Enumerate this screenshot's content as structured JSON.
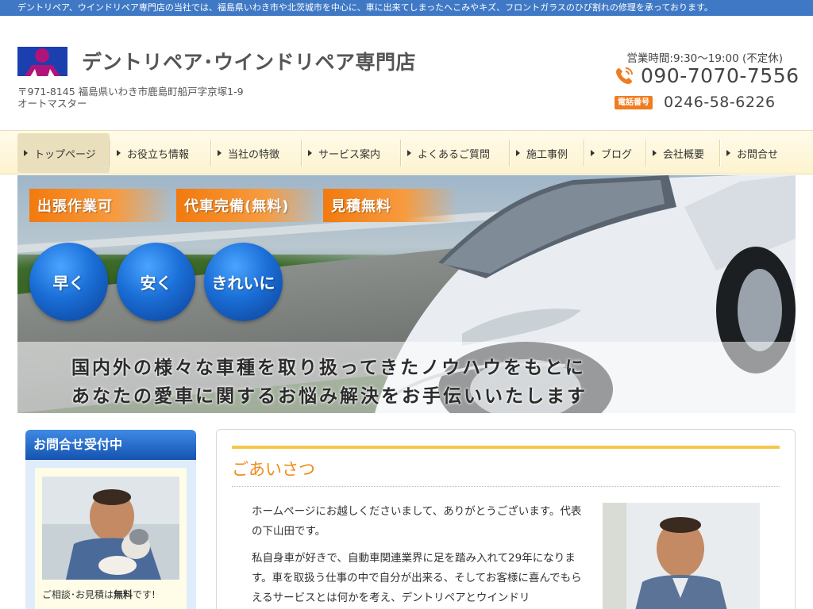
{
  "top_strip": {
    "text": "デントリペア、ウインドリペア専門店の当社では、福島県いわき市や北茨城市を中心に、車に出来てしまったへこみやキズ、フロントガラスのひび割れの修理を承っております。"
  },
  "header": {
    "title": "デントリペア･ウインドリペア専門店",
    "address_line1": "〒971-8145 福島県いわき市鹿島町船戸字京塚1-9",
    "address_line2": "オートマスター",
    "hours": "営業時間:9:30〜19:00 (不定休)",
    "phone_main": "090-7070-7556",
    "phone_badge": "電話番号",
    "phone_sub": "0246-58-6226"
  },
  "nav": {
    "items": [
      {
        "label": "トップページ"
      },
      {
        "label": "お役立ち情報"
      },
      {
        "label": "当社の特徴"
      },
      {
        "label": "サービス案内"
      },
      {
        "label": "よくあるご質問"
      },
      {
        "label": "施工事例"
      },
      {
        "label": "ブログ"
      },
      {
        "label": "会社概要"
      },
      {
        "label": "お問合せ"
      }
    ]
  },
  "hero": {
    "badges": [
      "出張作業可",
      "代車完備(無料)",
      "見積無料"
    ],
    "circles": [
      "早く",
      "安く",
      "きれいに"
    ],
    "line1": "国内外の様々な車種を取り扱ってきたノウハウをもとに",
    "line2": "あなたの愛車に関するお悩み解決をお手伝いいたします"
  },
  "sidebar": {
    "heading": "お問合せ受付中",
    "caption_prefix": "ご相談･お見積は",
    "caption_bold": "無料",
    "caption_suffix": "です!"
  },
  "content": {
    "heading": "ごあいさつ",
    "para1": "ホームページにお越しくださいまして、ありがとうございます。代表の下山田です。",
    "para2": "私自身車が好きで、自動車関連業界に足を踏み入れて29年になります。車を取扱う仕事の中で自分が出来る、そしてお客様に喜んでもらえるサービスとは何かを考え、デントリペアとウインドリ"
  },
  "colors": {
    "top_strip": "#3f79c5",
    "accent_orange": "#f08c1c",
    "nav_bg": "#fdf3cf",
    "sidebar_head": "#1553b0",
    "circle_blue": "#1a6ed6"
  }
}
